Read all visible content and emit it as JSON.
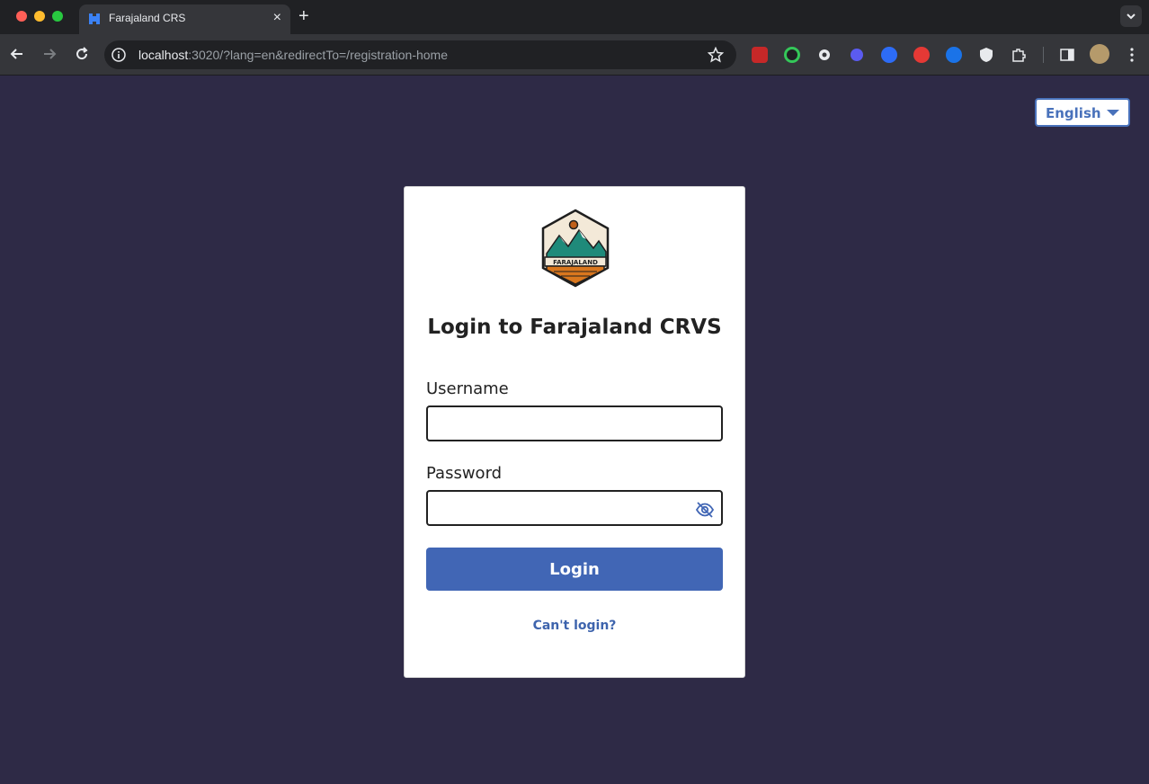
{
  "browser": {
    "tab_title": "Farajaland CRS",
    "tab_close": "×",
    "new_tab": "+",
    "url_host": "localhost",
    "url_rest": ":3020/?lang=en&redirectTo=/registration-home"
  },
  "language": {
    "selected": "English"
  },
  "login": {
    "title": "Login to Farajaland CRVS",
    "username_label": "Username",
    "username_value": "",
    "password_label": "Password",
    "password_value": "",
    "submit_label": "Login",
    "help_link": "Can't login?",
    "logo_text": "FARAJALAND"
  },
  "colors": {
    "page_bg": "#2e2a46",
    "primary": "#4166b5",
    "link": "#3e64ad"
  },
  "icons": {
    "back": "arrow-left-icon",
    "forward": "arrow-right-icon",
    "reload": "reload-icon",
    "info": "info-icon",
    "bookmark": "star-icon",
    "password_toggle": "eye-off-icon",
    "language_dropdown": "caret-down-icon"
  }
}
